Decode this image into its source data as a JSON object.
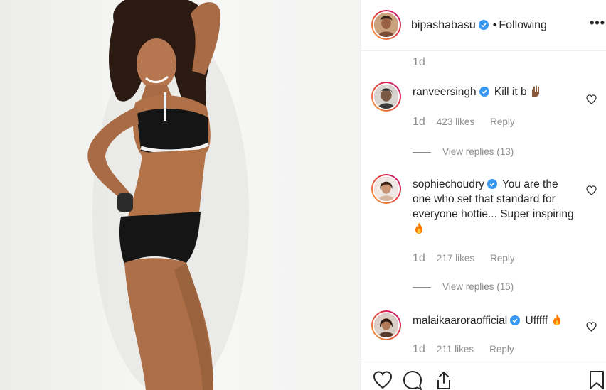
{
  "post": {
    "photo_alt": "",
    "author": {
      "username": "bipashabasu",
      "verified": true,
      "separator": "•",
      "follow_status": "Following"
    },
    "more_label": "•••"
  },
  "comments_section": {
    "caption_timestamp": "1d",
    "comments": [
      {
        "username": "ranveersingh",
        "verified": true,
        "text": "Kill it b",
        "emoji": "raised-hands",
        "timestamp": "1d",
        "likes": "423 likes",
        "reply_label": "Reply",
        "view_replies": "View replies (13)"
      },
      {
        "username": "sophiechoudry",
        "verified": true,
        "text": "You are the one who set that standard for everyone hottie... Super inspiring",
        "emoji": "fire",
        "timestamp": "1d",
        "likes": "217 likes",
        "reply_label": "Reply",
        "view_replies": "View replies (15)"
      },
      {
        "username": "malaikaaroraofficial",
        "verified": true,
        "text": "Ufffff",
        "emoji": "fire",
        "timestamp": "1d",
        "likes": "211 likes",
        "reply_label": "Reply"
      }
    ]
  },
  "actions": {
    "like": "heart-icon",
    "comment": "comment-icon",
    "share": "share-icon",
    "save": "bookmark-icon"
  },
  "colors": {
    "text": "#262626",
    "secondary": "#8e8e8e",
    "verified": "#3897f0",
    "divider": "#efefef",
    "fire": "#ff7a00"
  }
}
